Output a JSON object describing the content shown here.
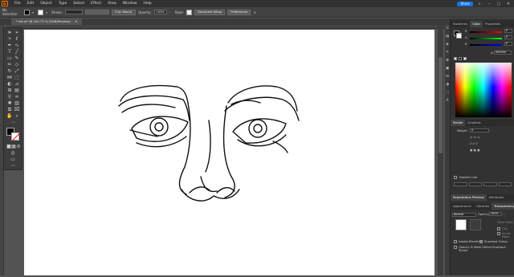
{
  "app": {
    "logo": "Ai"
  },
  "menu": [
    "File",
    "Edit",
    "Object",
    "Type",
    "Select",
    "Effect",
    "View",
    "Window",
    "Help"
  ],
  "share_label": "Share",
  "control": {
    "selection": "No Selection",
    "stroke_label": "Stroke:",
    "brush_label": "5 pt. Round",
    "opacity_label": "Opacity:",
    "opacity_value": "100%",
    "style_label": "Style:",
    "doc_setup": "Document Setup",
    "preferences": "Preferences"
  },
  "doc_tab": "* Art.ai* @ 100.73 % (RGB/Preview)",
  "panels": {
    "top_tabs": [
      "Swatches",
      "Color",
      "Properties"
    ],
    "color_channels": [
      {
        "label": "R",
        "value": "0"
      },
      {
        "label": "G",
        "value": "0"
      },
      {
        "label": "B",
        "value": "0"
      }
    ],
    "hex_value": "000000",
    "stroke": {
      "tabs": [
        "Stroke",
        "Gradient"
      ],
      "weight_label": "Weight:",
      "weight_value": "5",
      "dashed_label": "Dashed Line"
    },
    "sep_tabs": [
      "Separations Preview",
      "Attributes"
    ],
    "transparency": {
      "tabs": [
        "Appearance",
        "Libraries",
        "Transparency"
      ],
      "blend_mode": "Normal",
      "opacity_label": "Opacity:",
      "opacity_value": "100%",
      "make_mask": "Make Mask",
      "clip": "Clip",
      "invert_mask": "Invert Mask",
      "isolate_blending": "Isolate Blending",
      "knockout_group": "Knockout Group",
      "opacity_mask": "Opacity & Mask Define Knockout Shape"
    }
  },
  "colors": {
    "accent": "#1473e6",
    "fill": "#000000",
    "stroke": "#ffffff",
    "canvas": "#ffffff"
  }
}
